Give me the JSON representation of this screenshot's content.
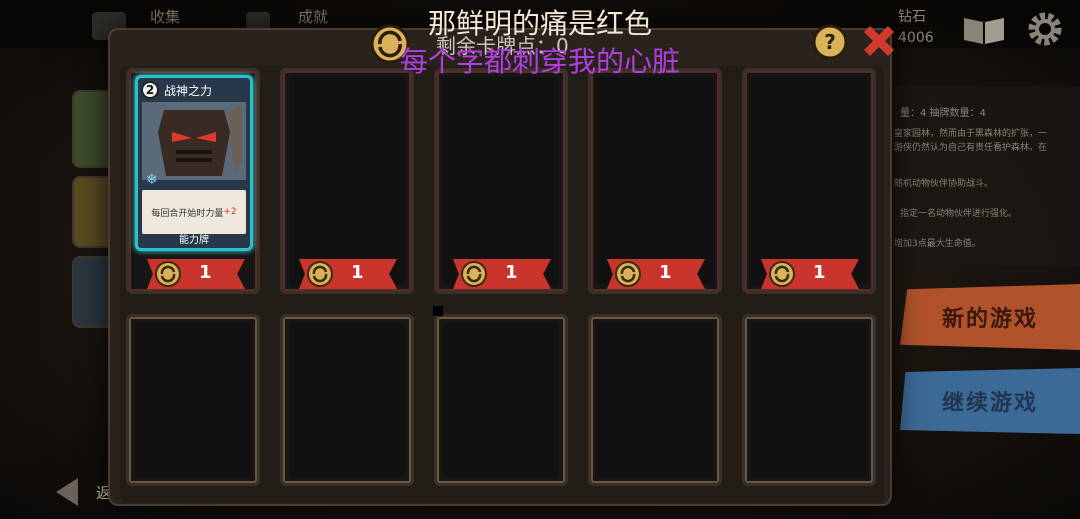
{
  "topbar": {
    "tab_collect": "收集",
    "tab_achieve": "成就",
    "diamond_label": "钻石",
    "diamond_value": "4006"
  },
  "info": {
    "line1": "量：4      抽牌数量：4",
    "line2": "皇家园林，然而由于黑森林的扩张，一",
    "line3": "游侠仍然认为自己有责任看护森林。在",
    "line4": "随机动物伙伴协助战斗。",
    "line5": "指定一名动物伙伴进行强化。",
    "line6": "增加3点最大生命值。"
  },
  "menu": {
    "new_game": "新的游戏",
    "continue_game": "继续游戏",
    "back": "返回"
  },
  "modal": {
    "remaining_label": "剩余卡牌点：0"
  },
  "card": {
    "cost_badge": "2",
    "title": "战神之力",
    "desc": "每回合开始时力量",
    "desc_plus": "+2",
    "type": "能力牌"
  },
  "slots": [
    {
      "cost": "1"
    },
    {
      "cost": "1"
    },
    {
      "cost": "1"
    },
    {
      "cost": "1"
    },
    {
      "cost": "1"
    }
  ],
  "captions": {
    "line1": "那鲜明的痛是红色",
    "line2": "每个字都刺穿我的心脏"
  },
  "colors": {
    "accent_cyan": "#28c4c9",
    "cost_red": "#c9352c",
    "new_game_orange": "#b0532c",
    "continue_blue": "#3c6a96"
  }
}
